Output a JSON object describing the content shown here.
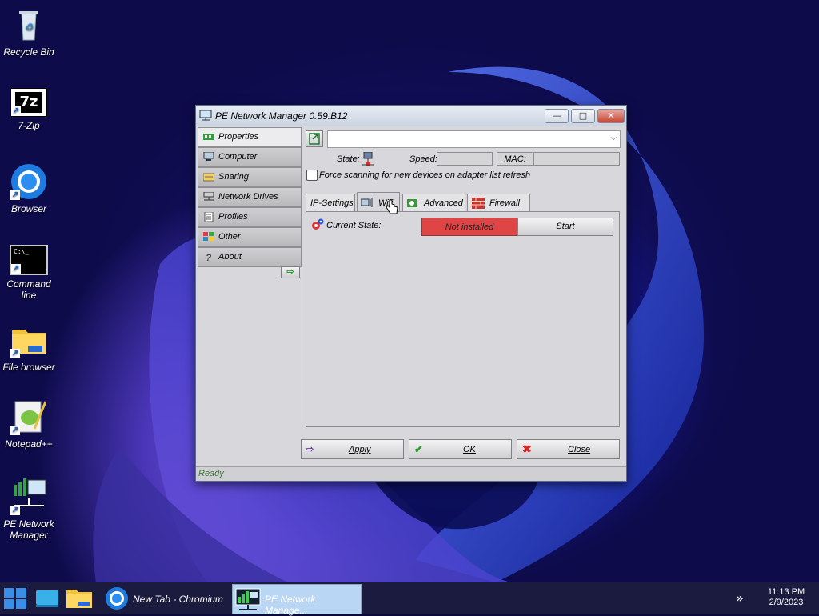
{
  "desktop": {
    "icons": [
      {
        "label": "Recycle Bin",
        "icon": "recycle-bin-icon"
      },
      {
        "label": "7-Zip",
        "icon": "7zip-icon",
        "glyph": "7z"
      },
      {
        "label": "Browser",
        "icon": "browser-icon"
      },
      {
        "label": "Command line",
        "icon": "command-line-icon",
        "glyph": "C:\\_"
      },
      {
        "label": "File browser",
        "icon": "folder-icon"
      },
      {
        "label": "Notepad++",
        "icon": "notepadpp-icon"
      },
      {
        "label": "PE Network Manager",
        "icon": "network-manager-icon"
      }
    ]
  },
  "window": {
    "title": "PE Network Manager 0.59.B12",
    "controls": {
      "minimize": "—",
      "maximize": "□",
      "close": "✕"
    }
  },
  "sidebar": {
    "items": [
      {
        "label": "Properties",
        "icon": "network-card-icon",
        "active": true
      },
      {
        "label": "Computer",
        "icon": "computer-icon"
      },
      {
        "label": "Sharing",
        "icon": "sharing-icon"
      },
      {
        "label": "Network Drives",
        "icon": "network-drive-icon"
      },
      {
        "label": "Profiles",
        "icon": "profiles-icon"
      },
      {
        "label": "Other",
        "icon": "other-icon"
      },
      {
        "label": "About",
        "icon": "about-icon"
      }
    ],
    "next_glyph": "⇨"
  },
  "adapter": {
    "select_value": "",
    "state_label": "State:",
    "speed_label": "Speed:",
    "speed_value": "",
    "mac_label": "MAC:",
    "mac_value": "",
    "force_scan_label": "Force scanning for new devices on adapter list refresh",
    "force_scan_checked": false
  },
  "tabs": [
    {
      "label": "IP-Settings",
      "active": false
    },
    {
      "label": "Wifi",
      "active": true
    },
    {
      "label": "Advanced",
      "active": false
    },
    {
      "label": "Firewall",
      "active": false
    }
  ],
  "wifi": {
    "current_state_label": "Current State:",
    "status_value": "Not installed",
    "status_color": "#e04545",
    "start_label": "Start"
  },
  "footer": {
    "apply_label": "Apply",
    "ok_label": "OK",
    "close_label": "Close"
  },
  "statusbar": {
    "text": "Ready"
  },
  "taskbar": {
    "items": [
      {
        "label": "New Tab - Chromium",
        "icon": "chromium-icon"
      },
      {
        "label": "PE Network Manage...",
        "icon": "network-manager-icon",
        "active": true
      }
    ],
    "overflow": "»",
    "time": "11:13 PM",
    "date": "2/9/2023"
  }
}
